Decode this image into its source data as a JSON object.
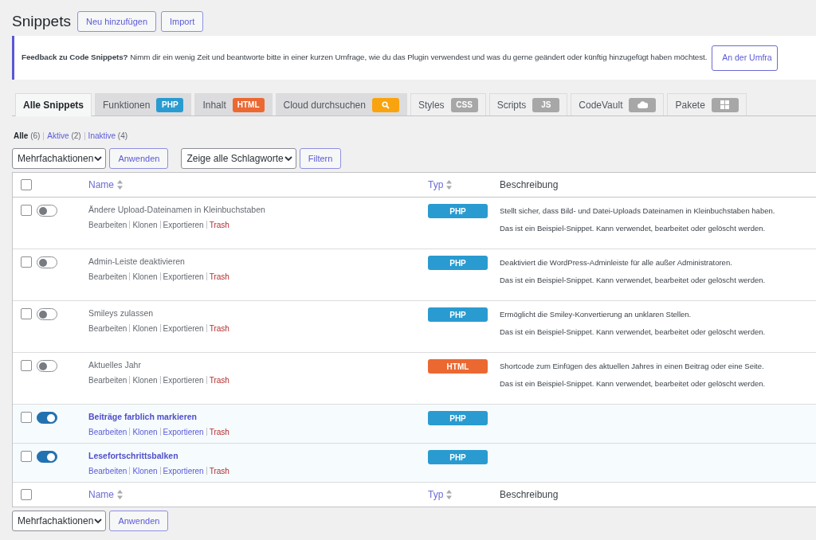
{
  "page": {
    "title": "Snippets",
    "header_buttons": [
      "Neu hinzufügen",
      "Import"
    ]
  },
  "notice": {
    "bold": "Feedback zu Code Snippets?",
    "text": "Nimm dir ein wenig Zeit und beantworte bitte in einer kurzen Umfrage, wie du das Plugin verwendest und was du gerne geändert oder künftig hinzugefügt haben möchtest.",
    "button": "An der Umfra"
  },
  "tabs": [
    {
      "label": "Alle Snippets",
      "selected": true,
      "featured": false
    },
    {
      "label": "Funktionen",
      "selected": false,
      "featured": true,
      "badge": {
        "kind": "text",
        "text": "PHP",
        "color": "#2a9bd0"
      }
    },
    {
      "label": "Inhalt",
      "selected": false,
      "featured": true,
      "badge": {
        "kind": "text",
        "text": "HTML",
        "color": "#ec6831"
      }
    },
    {
      "label": "Cloud durchsuchen",
      "selected": false,
      "featured": true,
      "badge": {
        "kind": "search",
        "color": "#f9a40e"
      }
    },
    {
      "label": "Styles",
      "selected": false,
      "featured": false,
      "badge": {
        "kind": "text",
        "text": "CSS",
        "color": "#a7a7a7"
      }
    },
    {
      "label": "Scripts",
      "selected": false,
      "featured": false,
      "badge": {
        "kind": "text",
        "text": "JS",
        "color": "#a7a7a7"
      }
    },
    {
      "label": "CodeVault",
      "selected": false,
      "featured": false,
      "badge": {
        "kind": "cloud",
        "color": "#a7a7a7"
      }
    },
    {
      "label": "Pakete",
      "selected": false,
      "featured": false,
      "badge": {
        "kind": "grid",
        "color": "#a7a7a7"
      }
    }
  ],
  "views": [
    {
      "label": "Alle",
      "count": "(6)",
      "selected": true
    },
    {
      "label": "Aktive",
      "count": "(2)",
      "selected": false
    },
    {
      "label": "Inaktive",
      "count": "(4)",
      "selected": false
    }
  ],
  "toolbar_top": {
    "bulk_select": "Mehrfachaktionen",
    "apply": "Anwenden",
    "tag_select": "Zeige alle Schlagworte",
    "filter": "Filtern"
  },
  "table": {
    "columns": [
      {
        "label": "Name",
        "sortable": true,
        "selected": false
      },
      {
        "label": "Typ",
        "sortable": true,
        "selected": false
      },
      {
        "label": "Beschreibung",
        "sortable": false,
        "selected": false
      }
    ],
    "rows": [
      {
        "name": "Ändere Upload-Dateinamen in Kleinbuchstaben",
        "active": false,
        "checked": false,
        "type": {
          "text": "PHP",
          "color": "#2a9bd0"
        },
        "actions": [
          "Bearbeiten",
          "Klonen",
          "Exportieren",
          "Trash"
        ],
        "description": [
          "Stellt sicher, dass Bild- und Datei-Uploads Dateinamen in Kleinbuchstaben haben.",
          "Das ist ein Beispiel-Snippet. Kann verwendet, bearbeitet oder gelöscht werden."
        ]
      },
      {
        "name": "Admin-Leiste deaktivieren",
        "active": false,
        "checked": false,
        "type": {
          "text": "PHP",
          "color": "#2a9bd0"
        },
        "actions": [
          "Bearbeiten",
          "Klonen",
          "Exportieren",
          "Trash"
        ],
        "description": [
          "Deaktiviert die WordPress-Adminleiste für alle außer Administratoren.",
          "Das ist ein Beispiel-Snippet. Kann verwendet, bearbeitet oder gelöscht werden."
        ]
      },
      {
        "name": "Smileys zulassen",
        "active": false,
        "checked": false,
        "type": {
          "text": "PHP",
          "color": "#2a9bd0"
        },
        "actions": [
          "Bearbeiten",
          "Klonen",
          "Exportieren",
          "Trash"
        ],
        "description": [
          "Ermöglicht die Smiley-Konvertierung an unklaren Stellen.",
          "Das ist ein Beispiel-Snippet. Kann verwendet, bearbeitet oder gelöscht werden."
        ]
      },
      {
        "name": "Aktuelles Jahr",
        "active": false,
        "checked": false,
        "type": {
          "text": "HTML",
          "color": "#ec6831"
        },
        "actions": [
          "Bearbeiten",
          "Klonen",
          "Exportieren",
          "Trash"
        ],
        "description": [
          "Shortcode zum Einfügen des aktuellen Jahres in einen Beitrag oder eine Seite.",
          "Das ist ein Beispiel-Snippet. Kann verwendet, bearbeitet oder gelöscht werden."
        ]
      },
      {
        "name": "Beiträge farblich markieren",
        "active": true,
        "checked": false,
        "type": {
          "text": "PHP",
          "color": "#2a9bd0"
        },
        "actions": [
          "Bearbeiten",
          "Klonen",
          "Exportieren",
          "Trash"
        ]
      },
      {
        "name": "Lesefortschrittsbalken",
        "active": true,
        "checked": false,
        "type": {
          "text": "PHP",
          "color": "#2a9bd0"
        },
        "actions": [
          "Bearbeiten",
          "Klonen",
          "Exportieren",
          "Trash"
        ]
      }
    ],
    "footer_columns": [
      {
        "label": "Name",
        "sortable": true,
        "selected": false
      },
      {
        "label": "Typ",
        "sortable": true,
        "selected": false
      },
      {
        "label": "Beschreibung",
        "sortable": false,
        "selected": false
      }
    ],
    "footer_checked": false,
    "header_checked": false
  },
  "toolbar_bottom": {
    "bulk_select": "Mehrfachaktionen",
    "apply": "Anwenden"
  }
}
